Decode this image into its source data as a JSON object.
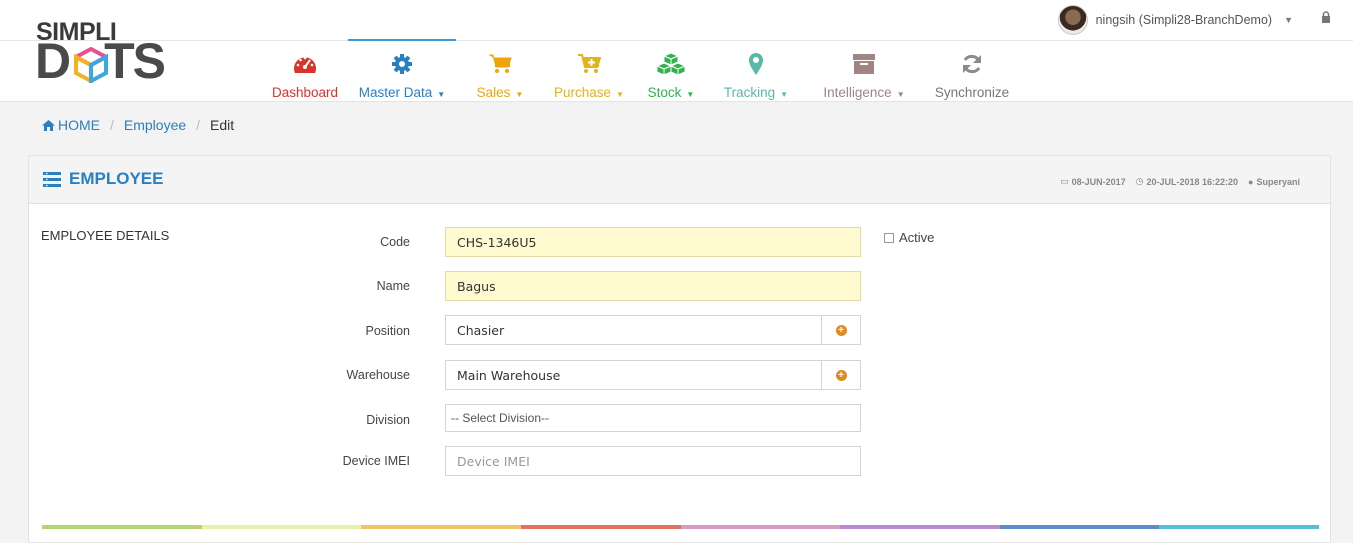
{
  "brand": {
    "line1": "SIMPLI",
    "line2": "D",
    "line2_rest": "TS"
  },
  "user": {
    "name": "ningsih (Simpli28-BranchDemo)"
  },
  "nav": [
    {
      "label": "Dashboard",
      "color": "#d9342b",
      "icon": "dashboard-icon",
      "caret": false
    },
    {
      "label": "Master Data",
      "color": "#2a7fc1",
      "icon": "gear-icon",
      "caret": true
    },
    {
      "label": "Sales",
      "color": "#f0a30a",
      "icon": "cart-icon",
      "caret": true
    },
    {
      "label": "Purchase",
      "color": "#e3b31a",
      "icon": "cart-plus-icon",
      "caret": true
    },
    {
      "label": "Stock",
      "color": "#2fb34a",
      "icon": "cubes-icon",
      "caret": true
    },
    {
      "label": "Tracking",
      "color": "#5bb7a8",
      "icon": "map-marker-icon",
      "caret": true
    },
    {
      "label": "Intelligence",
      "color": "#a08585",
      "icon": "archive-icon",
      "caret": true
    },
    {
      "label": "Synchronize",
      "color": "#777777",
      "icon": "sync-icon",
      "caret": false
    }
  ],
  "breadcrumb": {
    "home": "HOME",
    "section": "Employee",
    "current": "Edit"
  },
  "panel": {
    "title": "EMPLOYEE",
    "created": "08-JUN-2017",
    "updated": "20-JUL-2018 16:22:20",
    "user": "Superyani"
  },
  "form": {
    "section_title": "EMPLOYEE DETAILS",
    "code": {
      "label": "Code",
      "value": "CHS-1346U5"
    },
    "name": {
      "label": "Name",
      "value": "Bagus"
    },
    "position": {
      "label": "Position",
      "value": "Chasier"
    },
    "warehouse": {
      "label": "Warehouse",
      "value": "Main Warehouse"
    },
    "division": {
      "label": "Division",
      "value": "-- Select Division--"
    },
    "imei": {
      "label": "Device IMEI",
      "placeholder": "Device IMEI"
    },
    "active_label": "Active"
  },
  "colorbar": [
    "#b5d66f",
    "#eaf0a8",
    "#f3c26a",
    "#e0735f",
    "#d59bc4",
    "#b88bd0",
    "#5a8ccf",
    "#5bbcd6"
  ]
}
